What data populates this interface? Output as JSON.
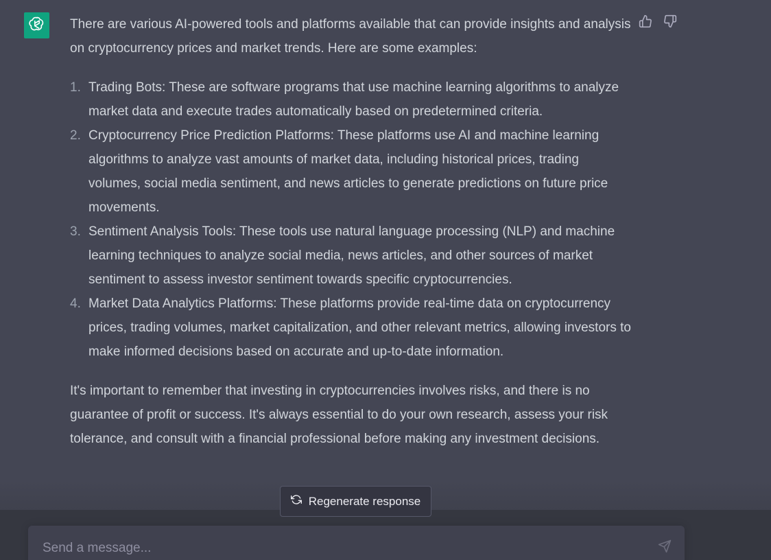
{
  "colors": {
    "background": "#444654",
    "avatar": "#10a37f",
    "text": "#d1d5db",
    "input_bg": "#40414f",
    "bottom_bar": "#353740"
  },
  "message": {
    "intro": "There are various AI-powered tools and platforms available that can provide insights and analysis on cryptocurrency prices and market trends. Here are some examples:",
    "items": [
      {
        "number": "1.",
        "text": "Trading Bots: These are software programs that use machine learning algorithms to analyze market data and execute trades automatically based on predetermined criteria."
      },
      {
        "number": "2.",
        "text": "Cryptocurrency Price Prediction Platforms: These platforms use AI and machine learning algorithms to analyze vast amounts of market data, including historical prices, trading volumes, social media sentiment, and news articles to generate predictions on future price movements."
      },
      {
        "number": "3.",
        "text": "Sentiment Analysis Tools: These tools use natural language processing (NLP) and machine learning techniques to analyze social media, news articles, and other sources of market sentiment to assess investor sentiment towards specific cryptocurrencies."
      },
      {
        "number": "4.",
        "text": "Market Data Analytics Platforms: These platforms provide real-time data on cryptocurrency prices, trading volumes, market capitalization, and other relevant metrics, allowing investors to make informed decisions based on accurate and up-to-date information."
      }
    ],
    "outro": "It's important to remember that investing in cryptocurrencies involves risks, and there is no guarantee of profit or success. It's always essential to do your own research, assess your risk tolerance, and consult with a financial professional before making any investment decisions."
  },
  "icons": {
    "avatar": "openai-logo-icon",
    "thumbs_up": "thumbs-up-icon",
    "thumbs_down": "thumbs-down-icon",
    "regenerate": "refresh-icon",
    "send": "paper-plane-icon"
  },
  "regenerate": {
    "label": "Regenerate response"
  },
  "composer": {
    "placeholder": "Send a message...",
    "value": ""
  }
}
